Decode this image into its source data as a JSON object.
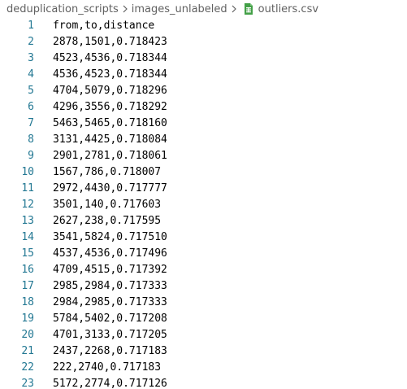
{
  "breadcrumb": {
    "items": [
      "deduplication_scripts",
      "images_unlabeled",
      "outliers.csv"
    ]
  },
  "file_icon": "csv-file-icon",
  "colors": {
    "line_number": "#237893",
    "icon_green": "#43a047",
    "text": "#000000",
    "breadcrumb_text": "#616161"
  },
  "lines": [
    {
      "num": "1",
      "text": "from,to,distance"
    },
    {
      "num": "2",
      "text": "2878,1501,0.718423"
    },
    {
      "num": "3",
      "text": "4523,4536,0.718344"
    },
    {
      "num": "4",
      "text": "4536,4523,0.718344"
    },
    {
      "num": "5",
      "text": "4704,5079,0.718296"
    },
    {
      "num": "6",
      "text": "4296,3556,0.718292"
    },
    {
      "num": "7",
      "text": "5463,5465,0.718160"
    },
    {
      "num": "8",
      "text": "3131,4425,0.718084"
    },
    {
      "num": "9",
      "text": "2901,2781,0.718061"
    },
    {
      "num": "10",
      "text": "1567,786,0.718007"
    },
    {
      "num": "11",
      "text": "2972,4430,0.717777"
    },
    {
      "num": "12",
      "text": "3501,140,0.717603"
    },
    {
      "num": "13",
      "text": "2627,238,0.717595"
    },
    {
      "num": "14",
      "text": "3541,5824,0.717510"
    },
    {
      "num": "15",
      "text": "4537,4536,0.717496"
    },
    {
      "num": "16",
      "text": "4709,4515,0.717392"
    },
    {
      "num": "17",
      "text": "2985,2984,0.717333"
    },
    {
      "num": "18",
      "text": "2984,2985,0.717333"
    },
    {
      "num": "19",
      "text": "5784,5402,0.717208"
    },
    {
      "num": "20",
      "text": "4701,3133,0.717205"
    },
    {
      "num": "21",
      "text": "2437,2268,0.717183"
    },
    {
      "num": "22",
      "text": "222,2740,0.717183"
    },
    {
      "num": "23",
      "text": "5172,2774,0.717126"
    }
  ]
}
